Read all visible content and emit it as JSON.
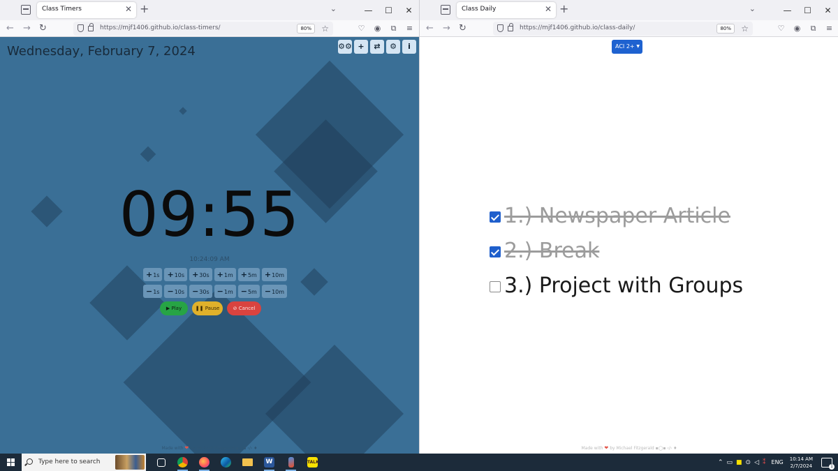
{
  "left_window": {
    "tab_title": "Class Timers",
    "url": "https://mjf1406.github.io/class-timers/",
    "zoom": "80%",
    "date": "Wednesday, February 7, 2024",
    "top_buttons": [
      "⚙⚙",
      "+",
      "⇄",
      "⚙",
      "i"
    ],
    "timer": "09:55",
    "clock_time": "10:24:09 AM",
    "plus_buttons": [
      "1s",
      "10s",
      "30s",
      "1m",
      "5m",
      "10m"
    ],
    "minus_buttons": [
      "1s",
      "10s",
      "30s",
      "1m",
      "5m",
      "10m"
    ],
    "controls": {
      "play": "Play",
      "pause": "Pause",
      "cancel": "Cancel"
    },
    "footer": {
      "made_with": "Made with",
      "by": "by Michael Fitzgerald"
    }
  },
  "right_window": {
    "tab_title": "Class Daily",
    "url": "https://mjf1406.github.io/class-daily/",
    "zoom": "80%",
    "class_select": "ACI 2+",
    "agenda": [
      {
        "text": "1.) Newspaper Article",
        "checked": true
      },
      {
        "text": "2.) Break",
        "checked": true
      },
      {
        "text": "3.) Project with Groups",
        "checked": false
      }
    ],
    "footer": {
      "made_with": "Made with",
      "by": "by Michael Fitzgerald"
    }
  },
  "taskbar": {
    "search_placeholder": "Type here to search",
    "language": "ENG",
    "time": "10:14 AM",
    "date": "2/7/2024",
    "notification_count": "1"
  },
  "colors": {
    "timer_bg": "#3a6f96",
    "play": "#27a445",
    "pause": "#e0b12b",
    "cancel": "#d9433f",
    "checkbox": "#1f5fcc",
    "select": "#1e62d0"
  }
}
